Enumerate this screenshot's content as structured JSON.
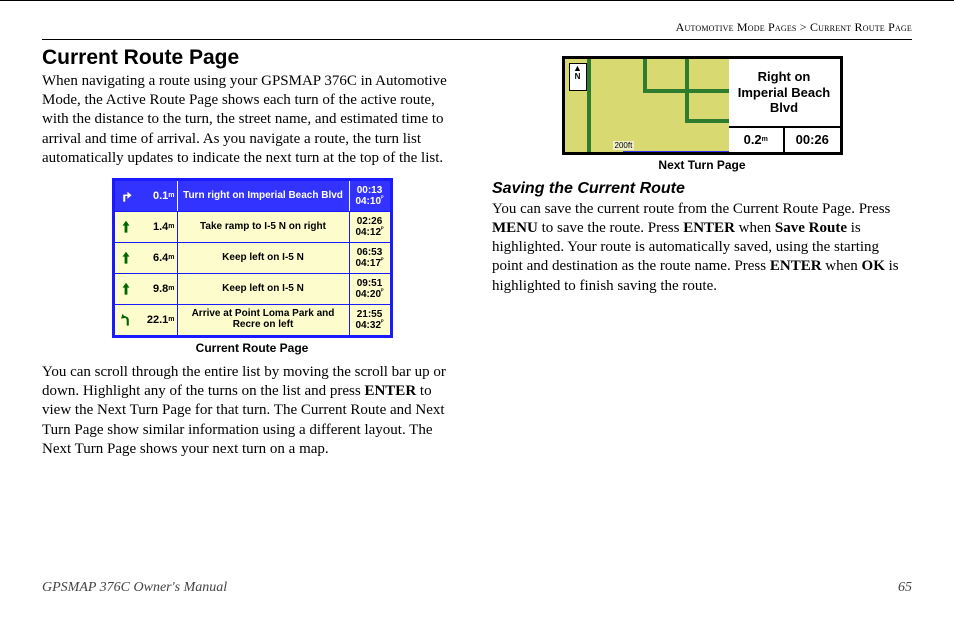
{
  "breadcrumb": {
    "a": "Automotive Mode Pages",
    "sep": ">",
    "b": "Current Route Page"
  },
  "heading": "Current Route Page",
  "para1": "When navigating a route using your GPSMAP 376C in Automotive Mode, the Active Route Page shows each turn of the active route, with the distance to the turn, the street name, and estimated time to arrival and time of arrival. As you navigate a route, the turn list automatically updates to indicate the next turn at the top of the list.",
  "route_rows": [
    {
      "dist": "0.1",
      "instr": "Turn right on Imperial Beach Blvd",
      "t1": "00:13",
      "t2": "04:10",
      "hl": true,
      "icon": "turn-right"
    },
    {
      "dist": "1.4",
      "instr": "Take ramp to I-5 N on right",
      "t1": "02:26",
      "t2": "04:12",
      "hl": false,
      "icon": "straight"
    },
    {
      "dist": "6.4",
      "instr": "Keep left on I-5 N",
      "t1": "06:53",
      "t2": "04:17",
      "hl": false,
      "icon": "straight"
    },
    {
      "dist": "9.8",
      "instr": "Keep left on I-5 N",
      "t1": "09:51",
      "t2": "04:20",
      "hl": false,
      "icon": "straight"
    },
    {
      "dist": "22.1",
      "instr": "Arrive at Point Loma Park and Recre on left",
      "t1": "21:55",
      "t2": "04:32",
      "hl": false,
      "icon": "bear-left"
    }
  ],
  "fig1_caption": "Current Route Page",
  "para2_a": "You can scroll through the entire list by moving the scroll bar up or down. Highlight any of the turns on the list and press ",
  "para2_k1": "ENTER",
  "para2_b": " to view the Next Turn Page for that turn. The Current Route and Next Turn Page show similar information using a different layout. The Next Turn Page shows your next turn on a map.",
  "next_turn": {
    "compass": "N",
    "scale": "200ft",
    "instr": "Right on Imperial Beach Blvd",
    "dist": "0.2",
    "dist_unit": "m",
    "time": "00:26"
  },
  "fig2_caption": "Next Turn Page",
  "sub_heading": "Saving the Current Route",
  "para3_a": "You can save the current route from the Current Route Page. Press ",
  "para3_k1": "MENU",
  "para3_b": " to save the route. Press ",
  "para3_k2": "ENTER",
  "para3_c": " when ",
  "para3_k3": "Save Route",
  "para3_d": " is highlighted. Your route is automatically saved, using the starting point and destination as the route name. Press ",
  "para3_k4": "ENTER",
  "para3_e": " when ",
  "para3_k5": "OK",
  "para3_f": " is highlighted to finish saving the route.",
  "footer": {
    "manual": "GPSMAP 376C Owner's Manual",
    "pagenum": "65"
  }
}
